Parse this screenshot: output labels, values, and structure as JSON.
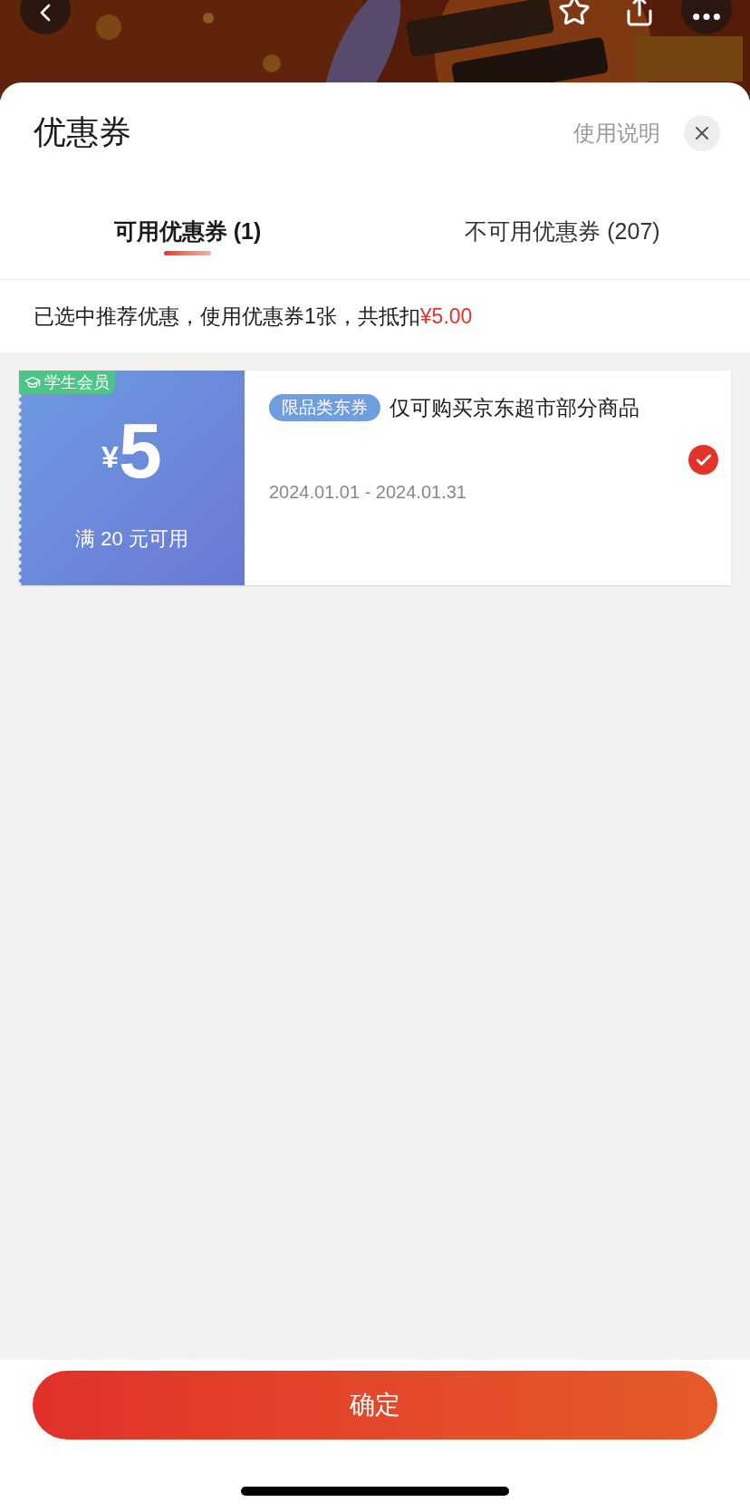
{
  "sheet": {
    "title": "优惠券",
    "help_link": "使用说明"
  },
  "tabs": [
    {
      "label": "可用优惠券 (1)",
      "selected": true
    },
    {
      "label": "不可用优惠券 (207)",
      "selected": false
    }
  ],
  "summary": {
    "text": "已选中推荐优惠，使用优惠券1张，共抵扣",
    "amount": "¥5.00"
  },
  "coupons": [
    {
      "badge": "学生会员",
      "currency": "¥",
      "value": "5",
      "condition": "满 20 元可用",
      "tag": "限品类东券",
      "description": "仅可购买京东超市部分商品",
      "validity": "2024.01.01 - 2024.01.31",
      "selected": true
    }
  ],
  "confirm_button": "确定"
}
